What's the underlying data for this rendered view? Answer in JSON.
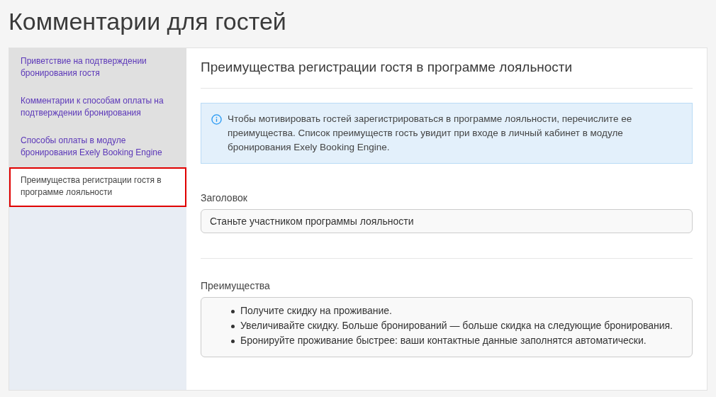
{
  "page_title": "Комментарии для гостей",
  "sidebar": {
    "items": [
      {
        "label": "Приветствие на подтверждении бронирования гостя",
        "selected": false
      },
      {
        "label": "Комментарии к способам оплаты на подтверждении бронирования",
        "selected": false
      },
      {
        "label": "Способы оплаты в модуле бронирования Exely Booking Engine",
        "selected": false
      },
      {
        "label": "Преимущества регистрации гостя в программе лояльности",
        "selected": true
      }
    ]
  },
  "section": {
    "title": "Преимущества регистрации гостя в программе лояльности",
    "info": "Чтобы мотивировать гостей зарегистрироваться в программе лояльности, перечислите ее преимущества. Список преимуществ гость увидит при входе в личный кабинет в модуле бронирования Exely Booking Engine.",
    "heading_field": {
      "label": "Заголовок",
      "value": "Станьте участником программы лояльности"
    },
    "benefits_field": {
      "label": "Преимущества",
      "items": [
        "Получите скидку на проживание.",
        "Увеличивайте скидку. Больше бронирований — больше скидка на следующие бронирования.",
        "Бронируйте проживание быстрее: ваши контактные данные заполнятся автоматически."
      ]
    }
  }
}
